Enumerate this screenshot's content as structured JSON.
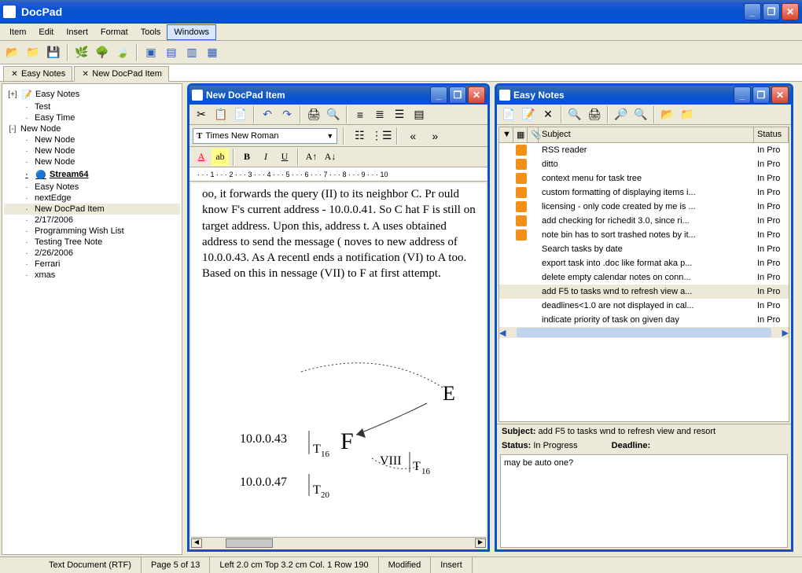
{
  "app": {
    "title": "DocPad"
  },
  "menu": {
    "item": "Item",
    "edit": "Edit",
    "insert": "Insert",
    "format": "Format",
    "tools": "Tools",
    "windows": "Windows"
  },
  "tabs": {
    "easy_notes": "Easy Notes",
    "new_docpad": "New DocPad Item"
  },
  "tree": {
    "items": [
      {
        "label": "Easy Notes",
        "level": 0,
        "expander": "+",
        "icon": "note"
      },
      {
        "label": "Test",
        "level": 1
      },
      {
        "label": "Easy Time",
        "level": 1
      },
      {
        "label": "New Node",
        "level": 0,
        "expander": "-"
      },
      {
        "label": "New Node",
        "level": 1
      },
      {
        "label": "New Node",
        "level": 1
      },
      {
        "label": "New Node",
        "level": 1
      },
      {
        "label": "Stream64",
        "level": 1,
        "bold": true,
        "icon": "globe"
      },
      {
        "label": "Easy Notes",
        "level": 1
      },
      {
        "label": "nextEdge",
        "level": 1
      },
      {
        "label": "New DocPad Item",
        "level": 1,
        "selected": true
      },
      {
        "label": "2/17/2006",
        "level": 1
      },
      {
        "label": "Programming Wish List",
        "level": 1
      },
      {
        "label": "Testing Tree Note",
        "level": 1
      },
      {
        "label": "2/26/2006",
        "level": 1
      },
      {
        "label": "Ferrari",
        "level": 1
      },
      {
        "label": "xmas",
        "level": 1
      }
    ]
  },
  "docpad_window": {
    "title": "New DocPad Item",
    "font": "Times New Roman",
    "ruler": "· · · 1 · · · 2 · · · 3 · · · 4 · · · 5 · · · 6 · · · 7 · · · 8 · · · 9 · · · 10",
    "content": "oo, it forwards the query (II) to its neighbor C. Pr ould know F's current address - 10.0.0.41. So C hat F is still on target address. Upon this, address t. A uses obtained address to send the message ( noves to new address of 10.0.0.43. As A recentl ends a notification (VI) to A too. Based on this in nessage (VII) to F at first attempt.",
    "diagram": {
      "e": "E",
      "f": "F",
      "viii": "VIII",
      "ip1": "10.0.0.43",
      "ip2": "10.0.0.47",
      "t16a": "T",
      "t16a_sub": "16",
      "t16b": "T",
      "t16b_sub": "16",
      "t20": "T",
      "t20_sub": "20"
    }
  },
  "easynotes_window": {
    "title": "Easy Notes",
    "columns": {
      "subject": "Subject",
      "status": "Status"
    },
    "tasks": [
      {
        "subject": "RSS reader",
        "status": "In Pro",
        "colored": true
      },
      {
        "subject": "ditto",
        "status": "In Pro",
        "colored": true
      },
      {
        "subject": "context menu for task tree",
        "status": "In Pro",
        "colored": true
      },
      {
        "subject": "custom formatting of displaying items i...",
        "status": "In Pro",
        "colored": true
      },
      {
        "subject": "licensing - only code created by me is ...",
        "status": "In Pro",
        "colored": true
      },
      {
        "subject": "add checking for richedit 3.0, since ri...",
        "status": "In Pro",
        "colored": true
      },
      {
        "subject": "note bin has to sort trashed notes by it...",
        "status": "In Pro",
        "colored": true
      },
      {
        "subject": "Search tasks by date",
        "status": "In Pro",
        "colored": false
      },
      {
        "subject": "export task into .doc like format aka p...",
        "status": "In Pro",
        "colored": false
      },
      {
        "subject": "delete empty calendar notes on conn...",
        "status": "In Pro",
        "colored": false
      },
      {
        "subject": "add F5 to tasks wnd to refresh view a...",
        "status": "In Pro",
        "colored": false,
        "selected": true
      },
      {
        "subject": "deadlines<1.0 are not displayed in cal...",
        "status": "In Pro",
        "colored": false
      },
      {
        "subject": "indicate priority of task on given day",
        "status": "In Pro",
        "colored": false
      }
    ],
    "detail": {
      "subject_label": "Subject:",
      "subject_value": "add F5 to tasks wnd to refresh view and resort",
      "status_label": "Status:",
      "status_value": "In Progress",
      "deadline_label": "Deadline:",
      "deadline_value": "",
      "body": "may be auto one?"
    }
  },
  "status": {
    "doctype": "Text Document (RTF)",
    "page": "Page 5 of 13",
    "pos": "Left 2.0 cm  Top 3.2 cm  Col. 1  Row 190",
    "modified": "Modified",
    "insert": "Insert"
  }
}
